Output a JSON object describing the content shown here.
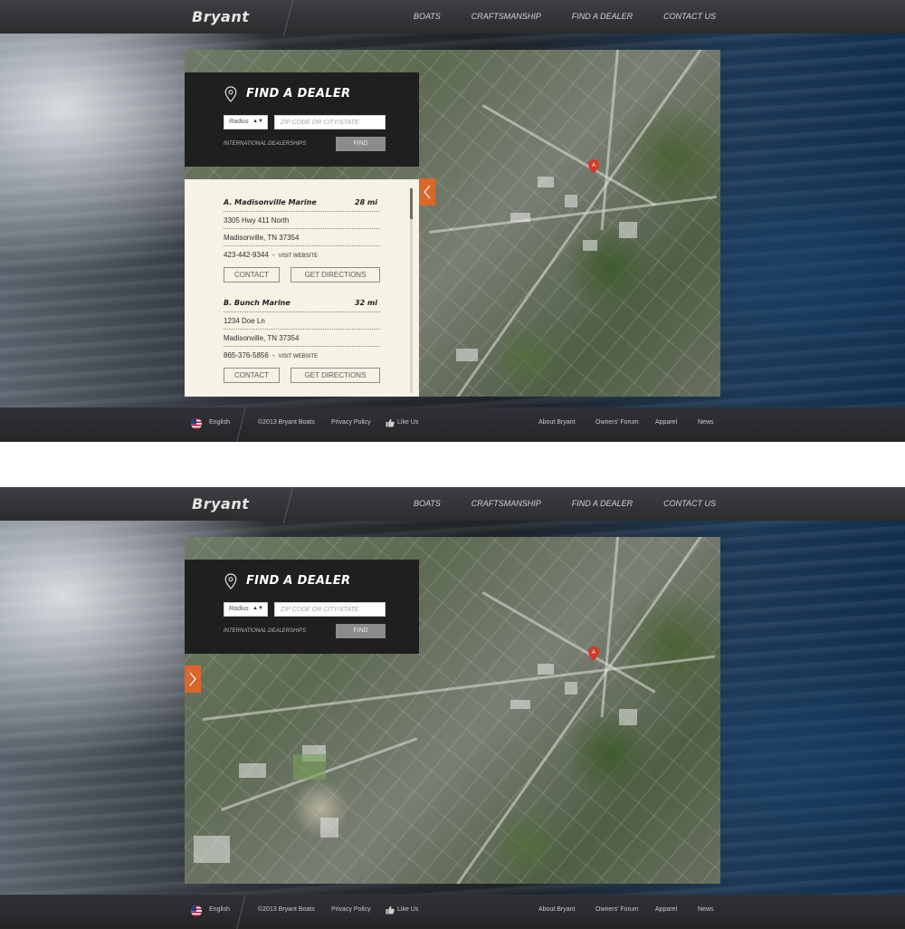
{
  "header": {
    "logo": "Bryant",
    "nav": [
      "BOATS",
      "CRAFTSMANSHIP",
      "FIND A DEALER",
      "CONTACT US"
    ]
  },
  "finder": {
    "title": "FIND A DEALER",
    "radius": "Radius",
    "zip_placeholder": "ZIP CODE OR CITY/STATE",
    "international": "INTERNATIONAL DEALERSHIPS",
    "find": "FIND"
  },
  "map": {
    "pin_label": "A"
  },
  "dealers": [
    {
      "name": "A. Madisonville Marine",
      "distance": "28 mi",
      "address": "3305 Hwy 411 North",
      "city": "Madisonville, TN 37354",
      "phone": "423-442-9344",
      "separator": "-",
      "website": "VISIT WEBSITE",
      "contact": "CONTACT",
      "directions": "GET DIRECTIONS"
    },
    {
      "name": "B. Bunch Marine",
      "distance": "32 mi",
      "address": "1234 Doe Ln",
      "city": "Madisonville, TN 37354",
      "phone": "865-376-5856",
      "separator": "-",
      "website": "VISIT WEBSITE",
      "contact": "CONTACT",
      "directions": "GET DIRECTIONS"
    }
  ],
  "footer": {
    "language": "English",
    "copyright": "©2013 Bryant Boats",
    "privacy": "Privacy Policy",
    "like": "Like Us",
    "links": [
      "About Bryant",
      "Owners' Forum",
      "Apparel",
      "News"
    ]
  },
  "colors": {
    "accent": "#d9662b",
    "panel_dark": "#1f1f20",
    "results_bg": "#f6f2e4",
    "topbar": "#2e3032",
    "pin": "#d23a2a"
  },
  "icons": {
    "finder": "map-pin-outline-icon",
    "collapse": "chevron-left-icon",
    "expand": "chevron-right-icon",
    "like": "thumbs-up-icon",
    "language": "us-flag-icon"
  }
}
